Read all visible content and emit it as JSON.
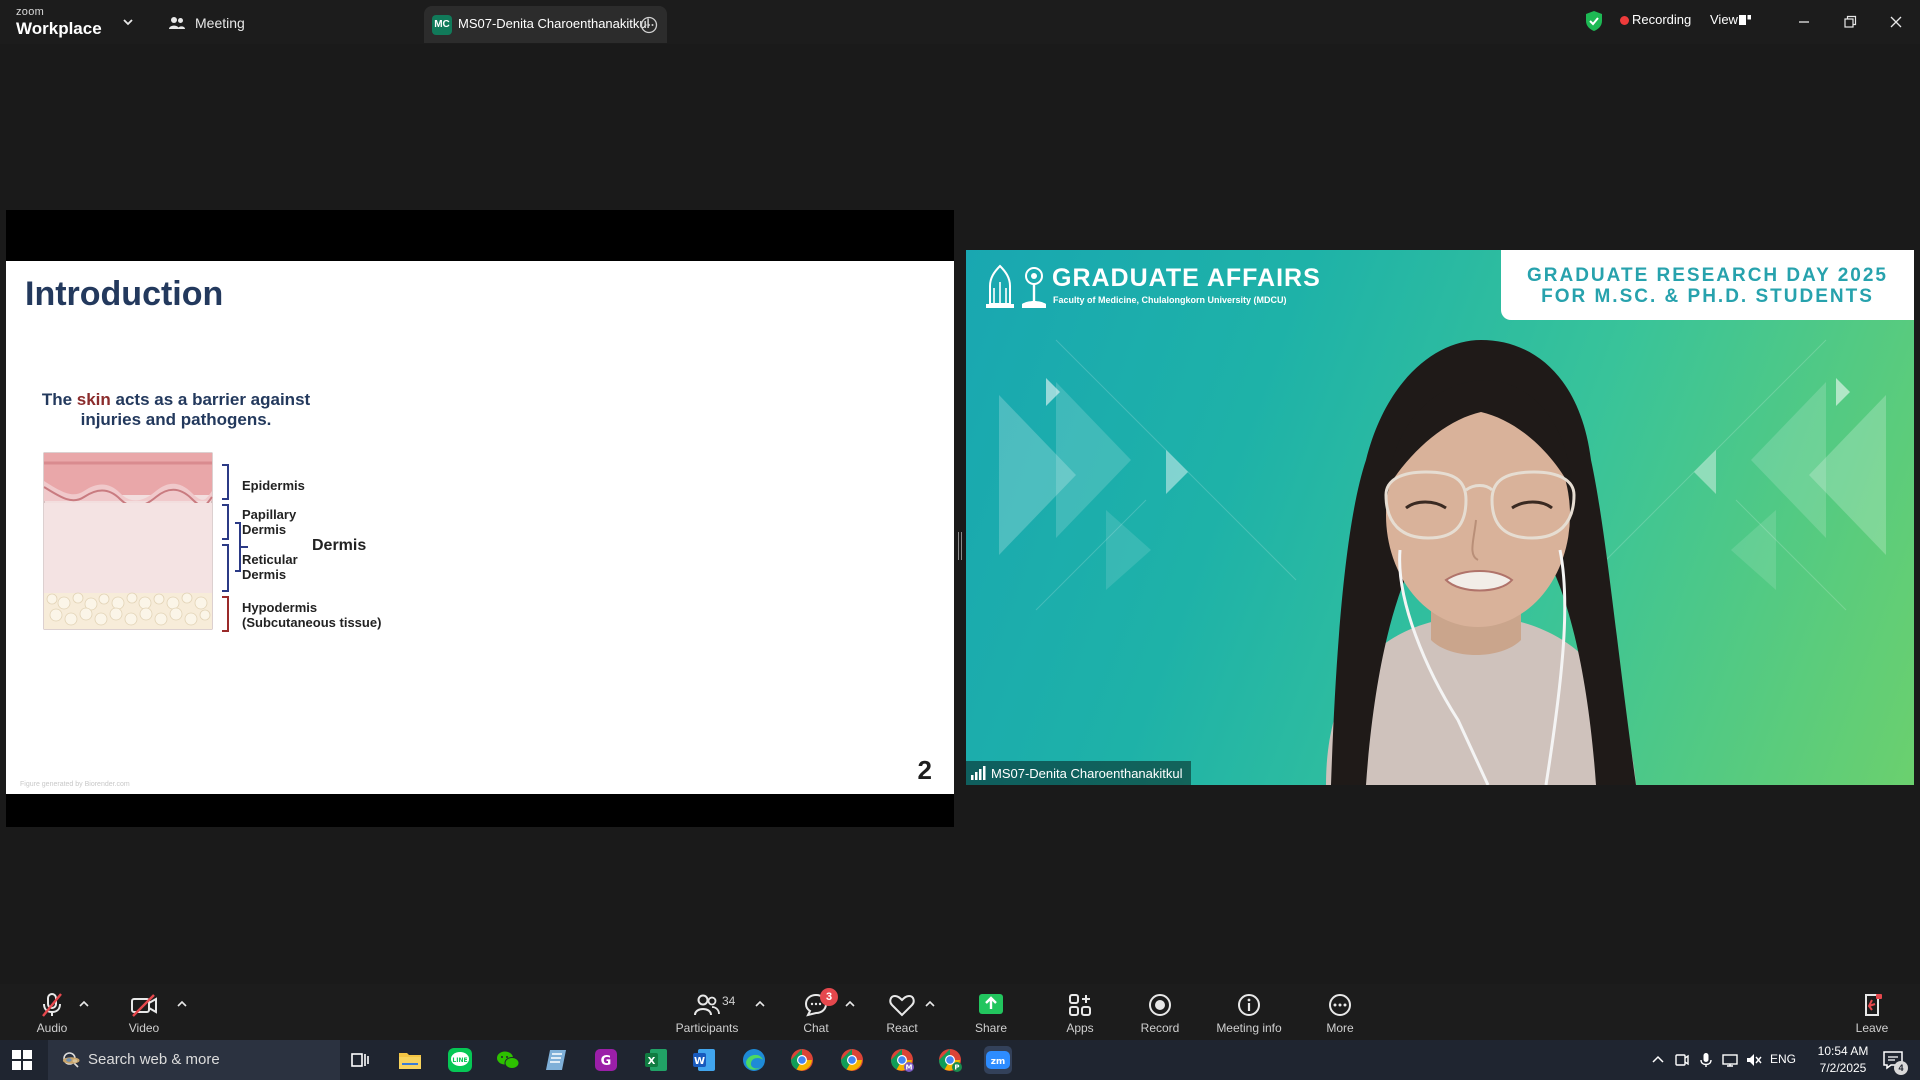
{
  "titlebar": {
    "brand_small": "zoom",
    "brand_big": "Workplace",
    "meeting_label": "Meeting",
    "active_tab": {
      "avatar": "MC",
      "title": "MS07-Denita Charoenthanakitkul"
    },
    "recording_label": "Recording",
    "view_label": "View"
  },
  "slide": {
    "title": "Introduction",
    "caption_prefix": "The ",
    "caption_highlight": "skin",
    "caption_suffix": " acts as a barrier against injuries and pathogens.",
    "layers": {
      "epidermis": "Epidermis",
      "papillary_1": "Papillary",
      "papillary_2": "Dermis",
      "reticular_1": "Reticular",
      "reticular_2": "Dermis",
      "dermis": "Dermis",
      "hypodermis_1": "Hypodermis",
      "hypodermis_2": "(Subcutaneous tissue)"
    },
    "page_number": "2",
    "credit": "Figure generated by Biorender.com"
  },
  "video": {
    "banner_title": "GRADUATE AFFAIRS",
    "banner_sub": "Faculty of Medicine, Chulalongkorn University (MDCU)",
    "event_line1": "GRADUATE RESEARCH DAY 2025",
    "event_line2": "FOR M.SC. & PH.D. STUDENTS",
    "participant_name": "MS07-Denita Charoenthanakitkul"
  },
  "controls": {
    "audio": "Audio",
    "video": "Video",
    "participants": "Participants",
    "participants_count": "34",
    "chat": "Chat",
    "chat_badge": "3",
    "react": "React",
    "share": "Share",
    "apps": "Apps",
    "record": "Record",
    "meeting_info": "Meeting info",
    "more": "More",
    "leave": "Leave"
  },
  "taskbar": {
    "search_text": "Search web & more",
    "language": "ENG",
    "time": "10:54 AM",
    "date": "7/2/2025",
    "notification_count": "4"
  },
  "colors": {
    "titlebar_bg": "#1c1c1c",
    "stage_bg": "#1a1a1a",
    "slide_title": "#23395d",
    "skin_highlight": "#8b2c2c",
    "video_teal": "#19a7b1",
    "video_green": "#6bd06e",
    "share_green": "#22c55e",
    "recording_red": "#ee3b3b",
    "taskbar_bg": "#1f2530"
  }
}
